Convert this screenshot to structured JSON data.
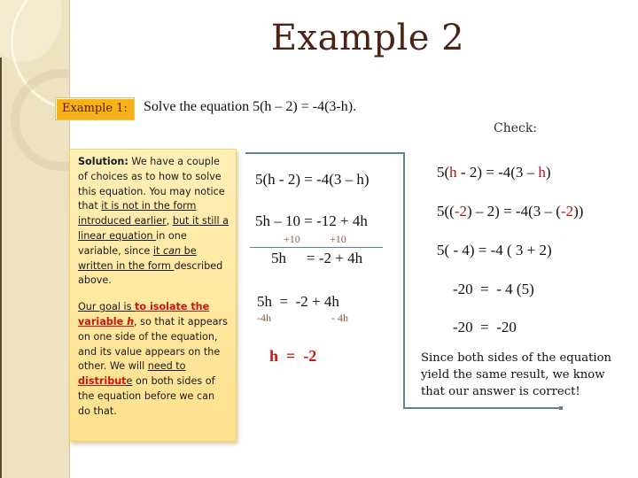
{
  "slide": {
    "title": "Example 2",
    "example_badge": "Example 1:",
    "problem": "Solve the equation 5(h – 2) = -4(3-h).",
    "check_label": "Check:"
  },
  "solution_box": {
    "p1": {
      "lead": "Solution:",
      "t1": " We have a couple of choices as to how to solve this equation.  You may notice that ",
      "u1": "it is not in the form introduced earlier",
      "t2": ", ",
      "u2": "but it still a linear equation ",
      "t3": "in one variable, since ",
      "u3a": "it ",
      "u3b": "can",
      "u3c": " be written in the form ",
      "t4": "described above."
    },
    "p2": {
      "u1": "Our goal is ",
      "red1": "to isolate the variable ",
      "red1_var": "h",
      "t1": ", so that it appears on one side of the equation, and its value appears on the other.  We will ",
      "u2": "need to",
      "t2": " ",
      "red2": "distribut",
      "u3": "e",
      "t3": " on both sides of the equation before we can do that."
    }
  },
  "work": {
    "line1": "5(h - 2) = -4(3 – h)",
    "line2": "5h – 10 = -12 + 4h",
    "add_left": "+10",
    "add_right": "+10",
    "line3_left": "5h",
    "line3_right": "= -2 + 4h",
    "line4": "5h  =  -2 + 4h",
    "sub_left": "-4h",
    "sub_right": "- 4h",
    "answer": "h  =  -2"
  },
  "check": {
    "c1": {
      "a": "5(",
      "h1": "h",
      "b": " - 2) = -4(3 – ",
      "h2": "h",
      "c": ")"
    },
    "c2": {
      "a": "5((",
      "h1": "-2",
      "b": ") – 2) = -4(3 – (",
      "h2": "-2",
      "c": "))"
    },
    "c3": "5( - 4) = -4 ( 3 + 2)",
    "c4": "-20  =  - 4 (5)",
    "c5": "-20  =  -20",
    "conclusion": "Since both sides of the equation yield the same result, we know that our answer is correct!"
  },
  "colors": {
    "title": "#4a2515",
    "badge": "#f7b21a",
    "highlight_red": "#c8160f",
    "bracket": "#5b8494",
    "note_fill": "#ffe89e"
  }
}
